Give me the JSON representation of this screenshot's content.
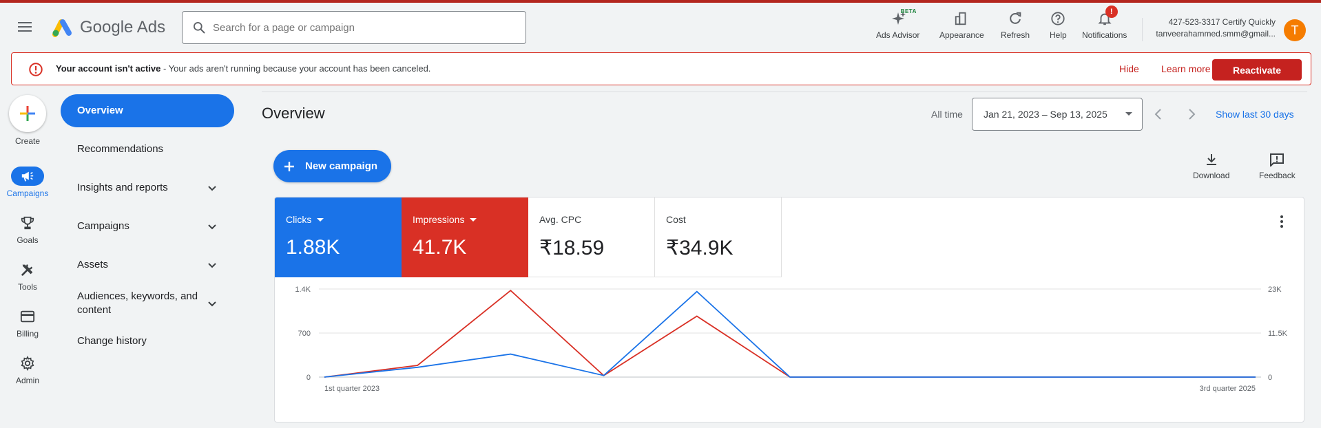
{
  "app": {
    "name": "Google Ads",
    "colors": {
      "primary": "#1a73e8",
      "error": "#d93025",
      "impressions": "#d93025",
      "avatar": "#f57c00"
    }
  },
  "header": {
    "menu_icon": "hamburger-menu-icon",
    "search_placeholder": "Search for a page or campaign",
    "tools": [
      {
        "label": "Ads Advisor",
        "icon": "sparkle-icon",
        "badge": "BETA"
      },
      {
        "label": "Appearance",
        "icon": "appearance-icon"
      },
      {
        "label": "Refresh",
        "icon": "refresh-icon"
      },
      {
        "label": "Help",
        "icon": "help-icon"
      },
      {
        "label": "Notifications",
        "icon": "bell-icon",
        "badge": "!"
      }
    ],
    "account": {
      "id_line": "427-523-3317 Certify Quickly",
      "email": "tanveerahammed.smm@gmail...",
      "avatar_letter": "T"
    }
  },
  "alert": {
    "title": "Your account isn't active",
    "message": " - Your ads aren't running because your account has been canceled.",
    "hide": "Hide",
    "learn_more": "Learn more",
    "reactivate": "Reactivate"
  },
  "rail": {
    "create": "Create",
    "items": [
      {
        "label": "Campaigns",
        "icon": "megaphone-icon",
        "active": true
      },
      {
        "label": "Goals",
        "icon": "trophy-icon"
      },
      {
        "label": "Tools",
        "icon": "tools-icon"
      },
      {
        "label": "Billing",
        "icon": "credit-card-icon"
      },
      {
        "label": "Admin",
        "icon": "gear-icon"
      }
    ]
  },
  "nav": {
    "items": [
      {
        "label": "Overview",
        "active": true
      },
      {
        "label": "Recommendations"
      },
      {
        "label": "Insights and reports",
        "expandable": true
      },
      {
        "label": "Campaigns",
        "expandable": true
      },
      {
        "label": "Assets",
        "expandable": true
      },
      {
        "label": "Audiences, keywords, and content",
        "expandable": true
      },
      {
        "label": "Change history"
      }
    ]
  },
  "main": {
    "title": "Overview",
    "all_time": "All time",
    "date_range": "Jan 21, 2023 – Sep 13, 2025",
    "show_last": "Show last 30 days",
    "new_campaign": "New campaign",
    "download": "Download",
    "feedback": "Feedback",
    "metrics": [
      {
        "name": "Clicks",
        "value": "1.88K"
      },
      {
        "name": "Impressions",
        "value": "41.7K"
      },
      {
        "name": "Avg. CPC",
        "value": "₹18.59"
      },
      {
        "name": "Cost",
        "value": "₹34.9K"
      }
    ]
  },
  "chart_data": {
    "type": "line",
    "x": [
      "1st quarter 2023",
      "2nd quarter 2023",
      "3rd quarter 2023",
      "4th quarter 2023",
      "1st quarter 2024",
      "2nd quarter 2024",
      "3rd quarter 2024",
      "4th quarter 2024",
      "1st quarter 2025",
      "2nd quarter 2025",
      "3rd quarter 2025"
    ],
    "x_tick_labels": [
      "1st quarter 2023",
      "3rd quarter 2025"
    ],
    "y_left": {
      "ticks": [
        "0",
        "700",
        "1.4K"
      ],
      "range": [
        0,
        1400
      ]
    },
    "y_right": {
      "ticks": [
        "0",
        "11.5K",
        "23K"
      ],
      "range": [
        0,
        23000
      ]
    },
    "series": [
      {
        "name": "Clicks",
        "axis": "left",
        "color": "#1a73e8",
        "values": [
          0,
          155,
          365,
          25,
          1360,
          0,
          0,
          0,
          0,
          0,
          0
        ]
      },
      {
        "name": "Impressions",
        "axis": "right",
        "color": "#d93025",
        "values": [
          0,
          3050,
          22600,
          400,
          15900,
          0,
          0,
          0,
          0,
          0,
          0
        ]
      }
    ],
    "grid": true,
    "legend": "none"
  }
}
